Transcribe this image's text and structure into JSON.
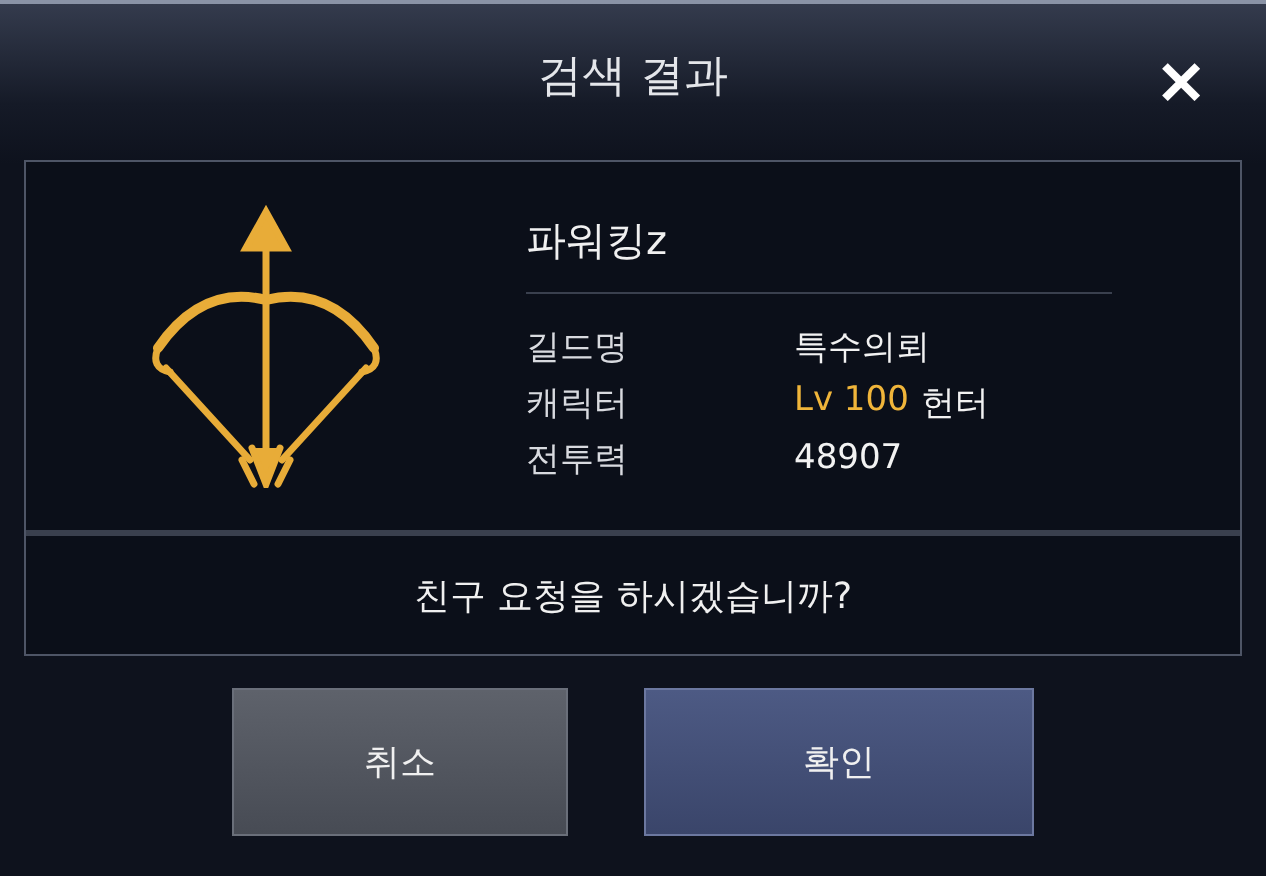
{
  "dialog": {
    "title": "검색 결과",
    "close": "✕"
  },
  "profile": {
    "name": "파워킹z",
    "fields": [
      {
        "label": "길드명",
        "parts": [
          {
            "text": "특수의뢰",
            "kind": "plain"
          }
        ]
      },
      {
        "label": "캐릭터",
        "parts": [
          {
            "text": "Lv 100",
            "kind": "level"
          },
          {
            "text": "헌터",
            "kind": "plain"
          }
        ]
      },
      {
        "label": "전투력",
        "parts": [
          {
            "text": "48907",
            "kind": "plain"
          }
        ]
      }
    ]
  },
  "question": "친구 요청을 하시겠습니까?",
  "buttons": [
    {
      "label": "취소",
      "kind": "cancel"
    },
    {
      "label": "확인",
      "kind": "confirm"
    }
  ]
}
